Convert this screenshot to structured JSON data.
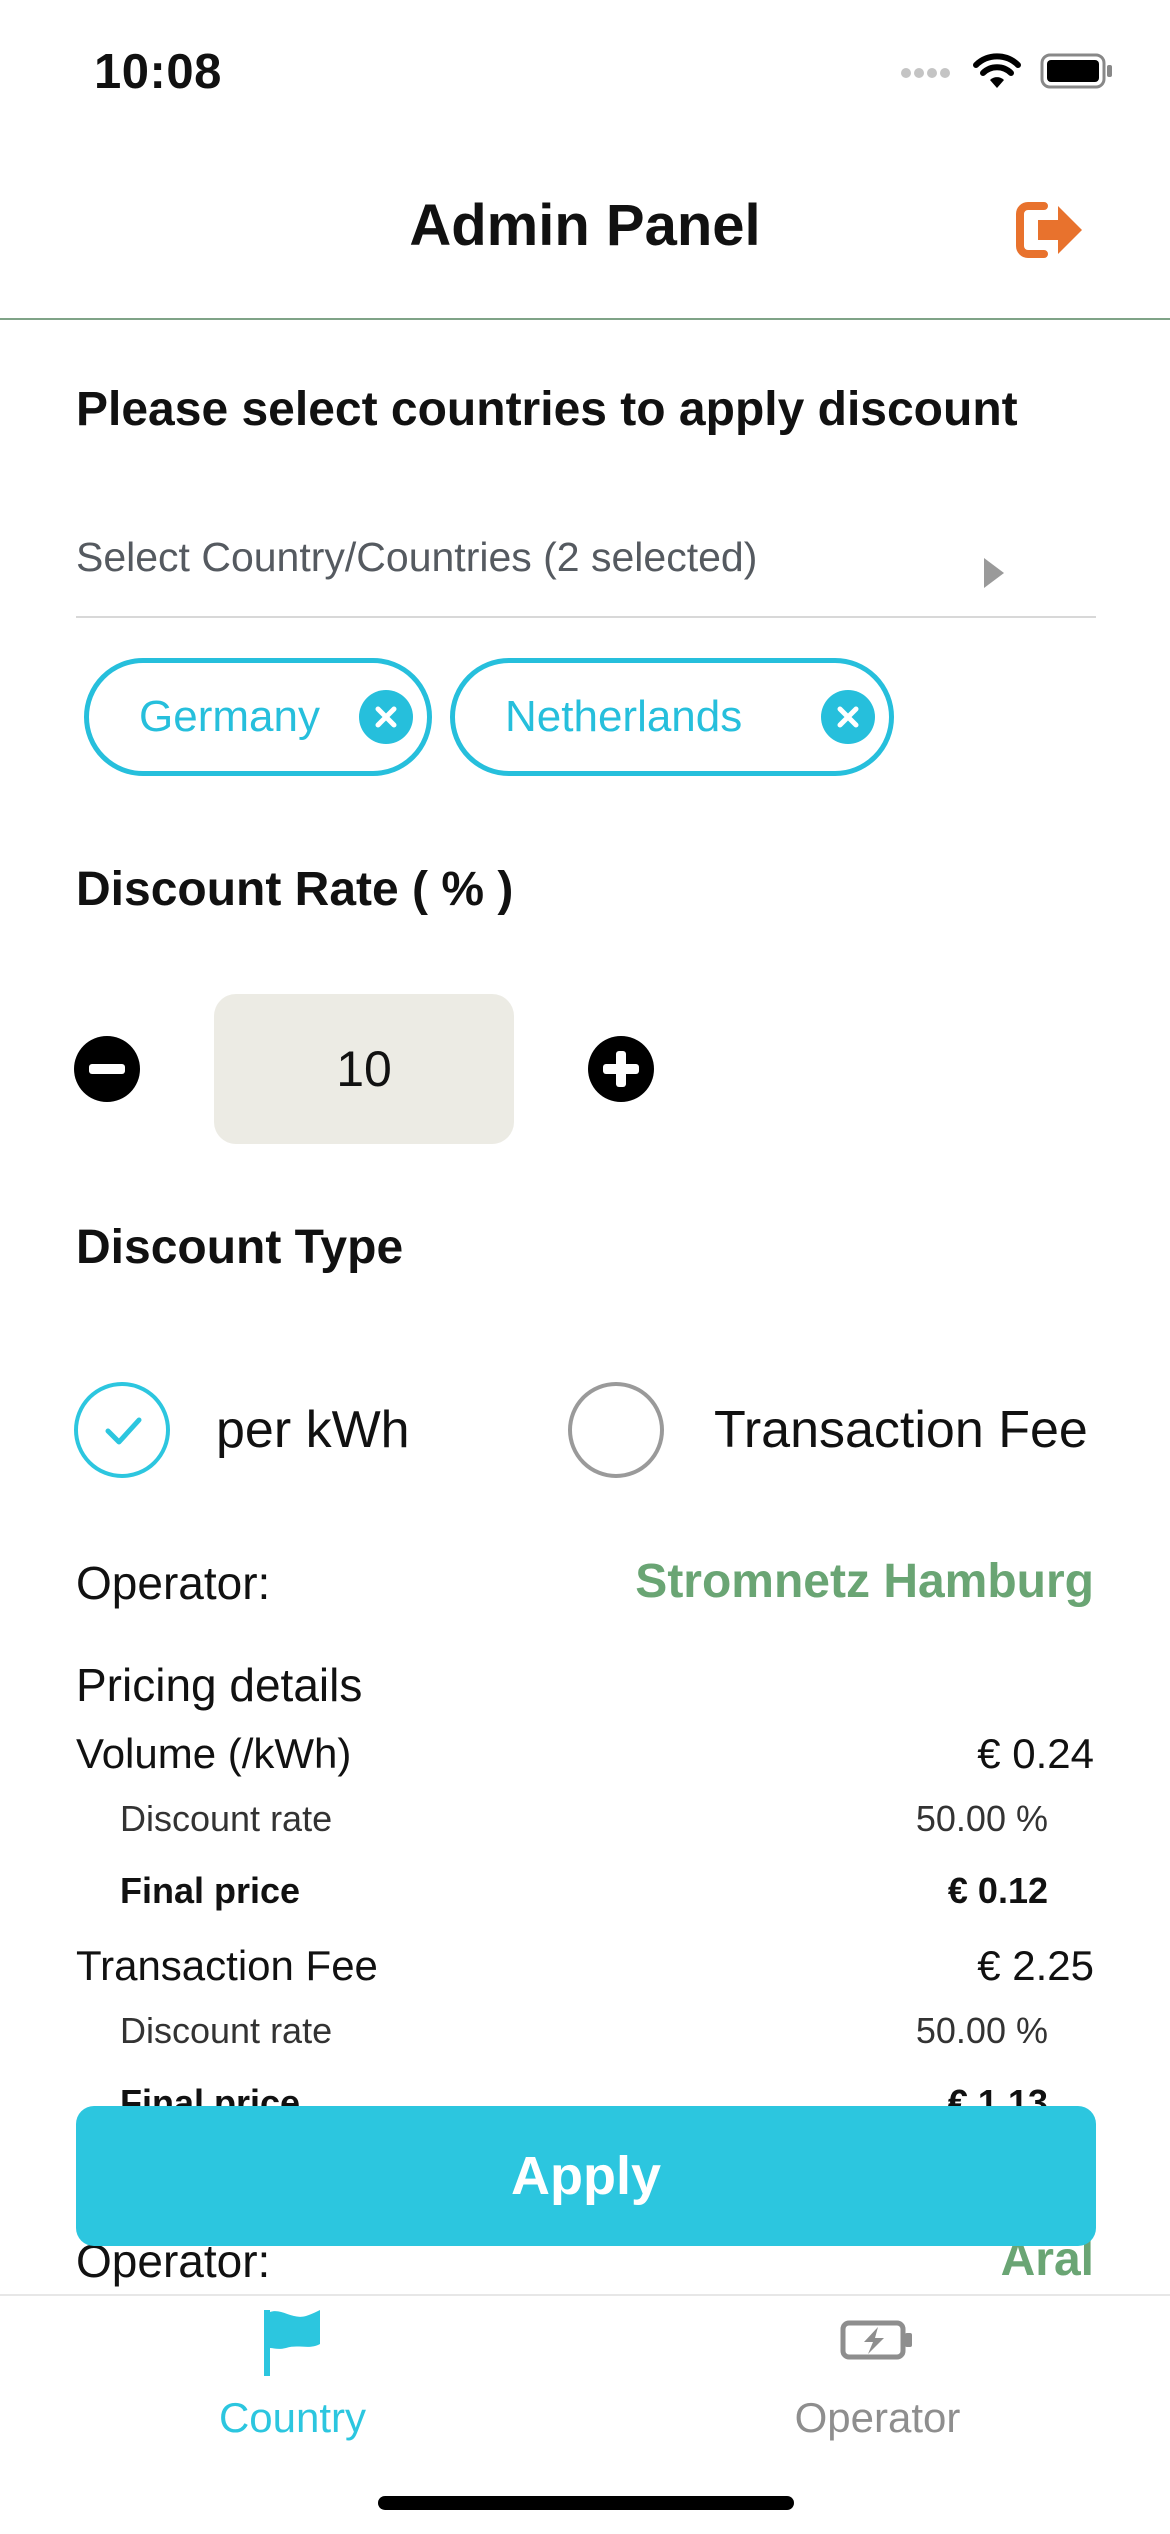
{
  "status_bar": {
    "time": "10:08"
  },
  "header": {
    "title": "Admin Panel"
  },
  "section_countries": {
    "title": "Please select countries to apply discount",
    "select_placeholder": "Select Country/Countries (2 selected)",
    "chips": [
      {
        "label": "Germany"
      },
      {
        "label": "Netherlands"
      }
    ]
  },
  "discount_rate": {
    "title": "Discount Rate ( % )",
    "value": "10"
  },
  "discount_type": {
    "title": "Discount Type",
    "options": [
      {
        "label": "per kWh",
        "selected": true
      },
      {
        "label": "Transaction Fee",
        "selected": false
      }
    ]
  },
  "operators": [
    {
      "label": "Operator:",
      "name": "Stromnetz Hamburg",
      "pricing_title": "Pricing details",
      "volume": {
        "label": "Volume (/kWh)",
        "price": "€ 0.24",
        "discount_label": "Discount rate",
        "discount_value": "50.00 %",
        "final_label": "Final price",
        "final_value": "€ 0.12"
      },
      "transaction": {
        "label": "Transaction Fee",
        "price": "€ 2.25",
        "discount_label": "Discount rate",
        "discount_value": "50.00 %",
        "final_label": "Final price",
        "final_value": "€ 1.13"
      }
    },
    {
      "label": "Operator:",
      "name": "Aral"
    }
  ],
  "apply_button": "Apply",
  "tabs": [
    {
      "label": "Country",
      "active": true
    },
    {
      "label": "Operator",
      "active": false
    }
  ],
  "colors": {
    "accent": "#2cc6df",
    "operator_green": "#6aa574",
    "logout_orange": "#e8722d",
    "inactive": "#8e8e8e"
  }
}
